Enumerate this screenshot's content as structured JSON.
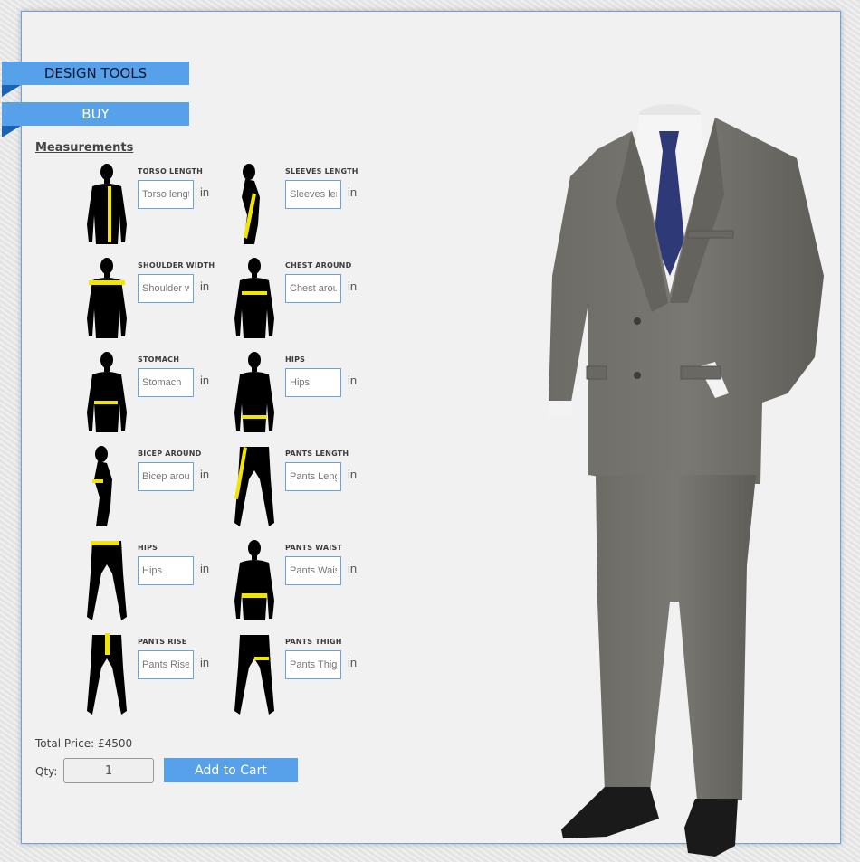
{
  "nav": {
    "design_tools_label": "DESIGN TOOLS",
    "buy_label": "BUY"
  },
  "measurements": {
    "title": "Measurements",
    "unit": "in",
    "items": [
      {
        "label": "TORSO LENGTH",
        "placeholder": "Torso length",
        "figure": "front-body-vertical-tape"
      },
      {
        "label": "SLEEVES LENGTH",
        "placeholder": "Sleeves length",
        "figure": "side-body-arm-tape"
      },
      {
        "label": "SHOULDER WIDTH",
        "placeholder": "Shoulder width",
        "figure": "front-body-shoulder-tape"
      },
      {
        "label": "CHEST AROUND",
        "placeholder": "Chest around",
        "figure": "front-body-chest-tape"
      },
      {
        "label": "STOMACH",
        "placeholder": "Stomach",
        "figure": "front-body-stomach-tape"
      },
      {
        "label": "HIPS",
        "placeholder": "Hips",
        "figure": "front-body-hips-tape"
      },
      {
        "label": "BICEP AROUND",
        "placeholder": "Bicep around",
        "figure": "side-body-bicep-tape"
      },
      {
        "label": "PANTS LENGTH",
        "placeholder": "Pants Length",
        "figure": "legs-length-tape"
      },
      {
        "label": "HIPS",
        "placeholder": "Hips",
        "figure": "legs-hips-tape"
      },
      {
        "label": "PANTS WAIST",
        "placeholder": "Pants Waist",
        "figure": "front-body-waist-tape"
      },
      {
        "label": "PANTS RISE",
        "placeholder": "Pants Rise",
        "figure": "legs-rise-tape"
      },
      {
        "label": "PANTS THIGH",
        "placeholder": "Pants Thigh",
        "figure": "legs-thigh-tape"
      }
    ]
  },
  "purchase": {
    "total_label": "Total Price: £4500",
    "qty_label": "Qty:",
    "qty_value": "1",
    "add_to_cart_label": "Add to Cart"
  },
  "colors": {
    "accent": "#57a0ea",
    "accent_dark": "#1a64b8",
    "tape": "#f2e600"
  }
}
